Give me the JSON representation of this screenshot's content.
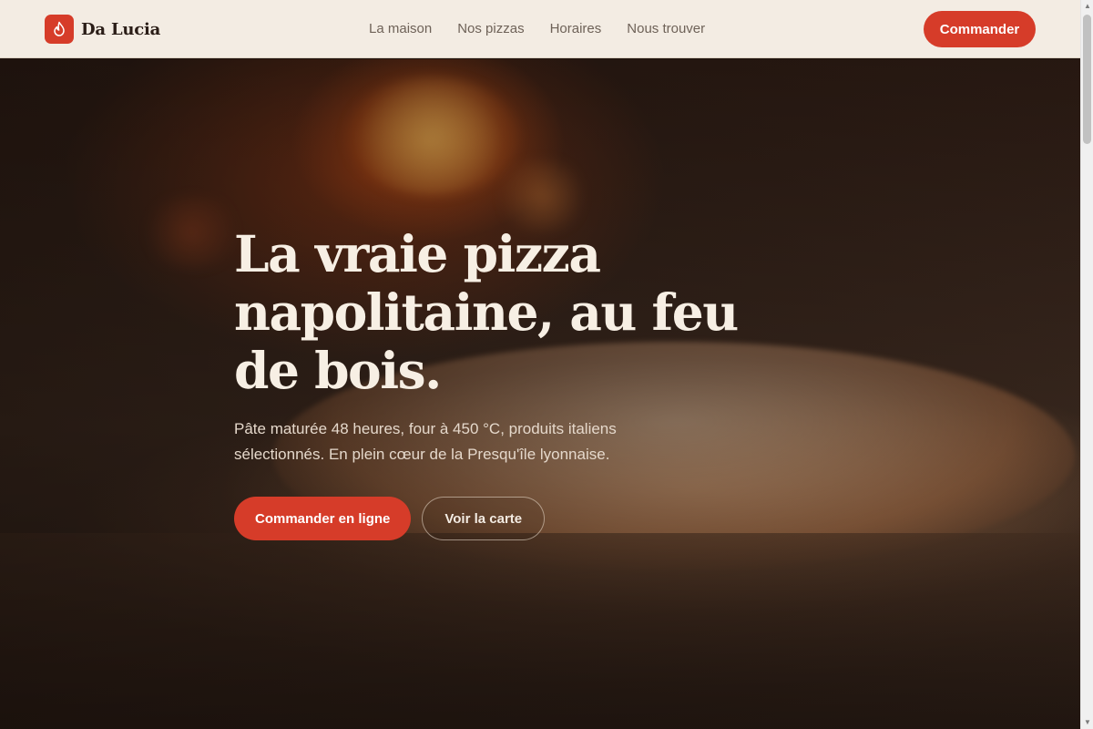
{
  "header": {
    "brand": "Da Lucia",
    "logo_icon": "flame-icon",
    "nav": [
      "La maison",
      "Nos pizzas",
      "Horaires",
      "Nous trouver"
    ],
    "cta": "Commander"
  },
  "hero": {
    "title": "La vraie pizza napolitaine, au feu de bois.",
    "subtitle": "Pâte maturée 48 heures, four à 450 °C, produits italiens sélectionnés. En plein cœur de la Presqu'île lyonnaise.",
    "primary_cta": "Commander en ligne",
    "secondary_cta": "Voir la carte"
  },
  "colors": {
    "accent": "#d63c29",
    "header_bg": "#f3ece3",
    "text_dark": "#2a1d17",
    "hero_text": "#f7efe4"
  }
}
